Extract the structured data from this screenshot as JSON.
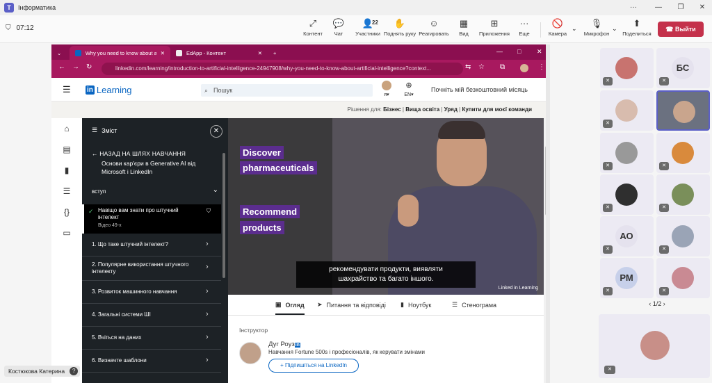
{
  "teams": {
    "app_title": "Інформатика",
    "timer": "07:12",
    "participants_count": "22",
    "toolbar": [
      {
        "label": "Контент",
        "icon": "share-screen-icon"
      },
      {
        "label": "Чат",
        "icon": "chat-icon"
      },
      {
        "label": "Участники",
        "icon": "people-icon"
      },
      {
        "label": "Поднять руку",
        "icon": "raise-hand-icon"
      },
      {
        "label": "Реагировать",
        "icon": "emoji-icon"
      },
      {
        "label": "Вид",
        "icon": "grid-view-icon"
      },
      {
        "label": "Приложения",
        "icon": "apps-icon"
      },
      {
        "label": "Еще",
        "icon": "more-icon"
      },
      {
        "label": "Камера",
        "icon": "camera-off-icon"
      },
      {
        "label": "Микрофон",
        "icon": "mic-off-icon"
      },
      {
        "label": "Поделиться",
        "icon": "share-icon"
      }
    ],
    "leave_label": "Выйти",
    "pager": "1/2",
    "participant_initials": [
      "БС",
      "АО",
      "РМ"
    ],
    "presenter_name": "Костюкова Катерина"
  },
  "browser": {
    "tabs": [
      {
        "title": "Why you need to know about a",
        "active": true
      },
      {
        "title": "EdApp - Контент",
        "active": false
      }
    ],
    "url": "linkedin.com/learning/introduction-to-artificial-intelligence-24947908/why-you-need-to-know-about-artificial-intelligence?context..."
  },
  "linkedin": {
    "brand": "Learning",
    "search_placeholder": "Пошук",
    "me_label": "я",
    "lang_label": "EN",
    "cta": "Почніть мій безкоштовний місяць",
    "solutions_label": "Рішення для:",
    "solutions": [
      "Бізнес",
      "Вища освіта",
      "Уряд",
      "Купити для моєї команди"
    ]
  },
  "toc": {
    "header": "Зміст",
    "back_label": "НАЗАД НА ШЛЯХ НАВЧАННЯ",
    "path_title": "Основи кар'єри в Generative AI від Microsoft і LinkedIn",
    "section": "вступ",
    "current": {
      "title": "Навіщо вам знати про штучний інтелект",
      "duration": "Відео 49-х"
    },
    "items": [
      "1. Що таке штучний інтелект?",
      "2. Популярне використання штучного інтелекту",
      "3. Розвиток машинного навчання",
      "4. Загальні системи ШІ",
      "5. Вчіться на даних",
      "6. Визначте шаблони"
    ]
  },
  "video": {
    "labels": [
      "Discover",
      "pharmaceuticals",
      "Recommend",
      "products"
    ],
    "caption_line1": "рекомендувати продукти, виявляти",
    "caption_line2": "шахрайство та багато іншого.",
    "watermark": "Linked in Learning"
  },
  "content_tabs": [
    "Огляд",
    "Питання та відповіді",
    "Ноутбук",
    "Стенограма"
  ],
  "instructor": {
    "heading": "Інструктор",
    "name": "Дуг Роуз",
    "description": "Навчання Fortune 500s і професіоналів, як керувати змінами",
    "follow_label": "+ Підпишіться на LinkedIn"
  }
}
